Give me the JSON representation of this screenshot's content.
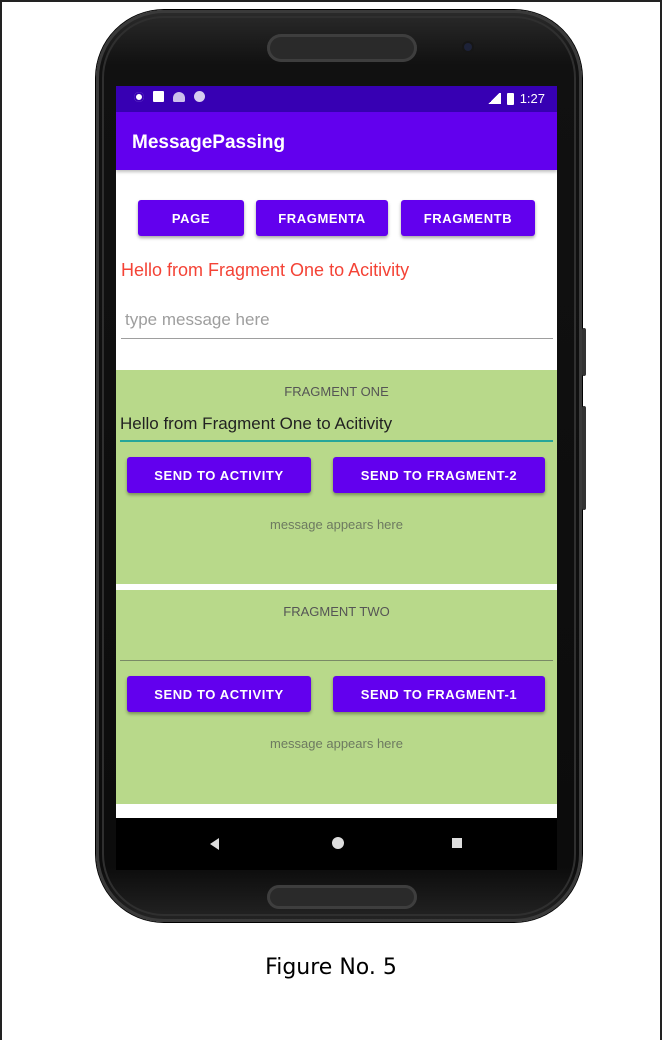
{
  "statusbar": {
    "time": "1:27",
    "icons_left": [
      "gear-icon",
      "box-icon",
      "wifi-icon",
      "circle-icon"
    ],
    "icons_right": [
      "signal-icon",
      "battery-icon"
    ]
  },
  "appbar": {
    "title": "MessagePassing"
  },
  "top_buttons": [
    "PAGE",
    "FRAGMENTA",
    "FRAGMENTB"
  ],
  "activity": {
    "message": "Hello from Fragment One to Acitivity",
    "input_placeholder": "type message here"
  },
  "fragment_one": {
    "title": "FRAGMENT ONE",
    "input_value": "Hello from Fragment One to Acitivity",
    "send_activity_label": "SEND TO ACTIVITY",
    "send_fragment_label": "SEND TO FRAGMENT-2",
    "message": "message appears here"
  },
  "fragment_two": {
    "title": "FRAGMENT TWO",
    "input_value": "",
    "send_activity_label": "SEND TO ACTIVITY",
    "send_fragment_label": "SEND TO FRAGMENT-1",
    "message": "message appears here"
  },
  "caption": "Figure No. 5",
  "colors": {
    "primary": "#6200ee",
    "primary_dark": "#3700b3",
    "fragment_bg": "#b8d98a",
    "message_red": "#f44336",
    "accent": "#26a69a"
  }
}
